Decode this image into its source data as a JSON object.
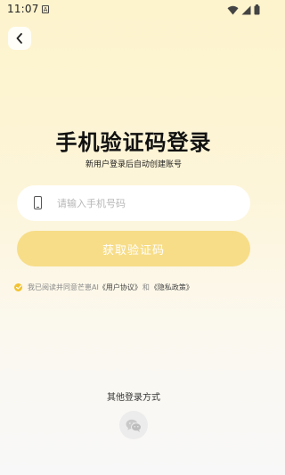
{
  "status_bar": {
    "time": "11:07",
    "notification_glyph": "A",
    "icons": [
      "wifi-icon",
      "cellular-signal-icon",
      "battery-icon"
    ]
  },
  "header": {
    "back_icon": "chevron-left-icon"
  },
  "main": {
    "title": "手机验证码登录",
    "subtitle": "新用户登录后自动创建账号",
    "phone_field": {
      "icon": "phone-icon",
      "placeholder": "请输入手机号码",
      "value": ""
    },
    "get_code_button": "获取验证码",
    "agreement": {
      "checked": true,
      "prefix": "我已阅读并同意芒崽AI",
      "user_agreement": "《用户协议》",
      "and": "和",
      "privacy_policy": "《隐私政策》"
    }
  },
  "footer": {
    "other_login_label": "其他登录方式",
    "wechat_icon": "wechat-icon"
  },
  "colors": {
    "accent": "#f2c230",
    "button_disabled": "#f7dd88",
    "background_top": "#fdf3cc"
  }
}
